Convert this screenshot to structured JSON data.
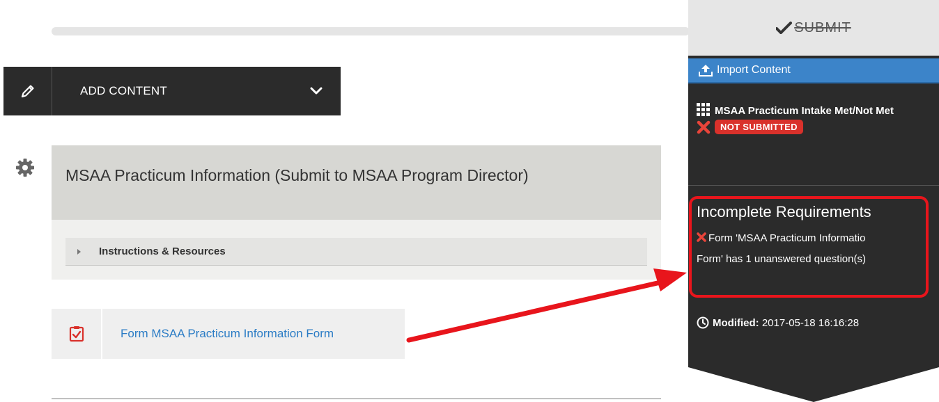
{
  "toolbar": {
    "add_content_label": "ADD CONTENT"
  },
  "section": {
    "title": "MSAA Practicum Information (Submit to MSAA Program Director)",
    "instructions_label": "Instructions & Resources",
    "form_link": "Form MSAA Practicum Information Form"
  },
  "panel": {
    "submit_label": "SUBMIT",
    "import_label": "Import Content",
    "item_title": "MSAA Practicum Intake Met/Not Met",
    "item_status": "NOT SUBMITTED",
    "incomplete_heading": "Incomplete Requirements",
    "requirement_line1": "Form 'MSAA Practicum Informatio",
    "requirement_line2": "Form' has 1 unanswered question(s)",
    "modified_label": "Modified:",
    "modified_value": "2017-05-18 16:16:28"
  },
  "colors": {
    "dark": "#2b2b2b",
    "accent_blue": "#3c84c9",
    "link_blue": "#2b7cc5",
    "error_red": "#d9312b",
    "highlight_red": "#e8151c"
  },
  "icons": [
    "pencil-icon",
    "chevron-down-icon",
    "gear-icon",
    "clipboard-check-icon",
    "check-icon",
    "upload-icon",
    "grid-icon",
    "x-icon",
    "clock-icon"
  ]
}
